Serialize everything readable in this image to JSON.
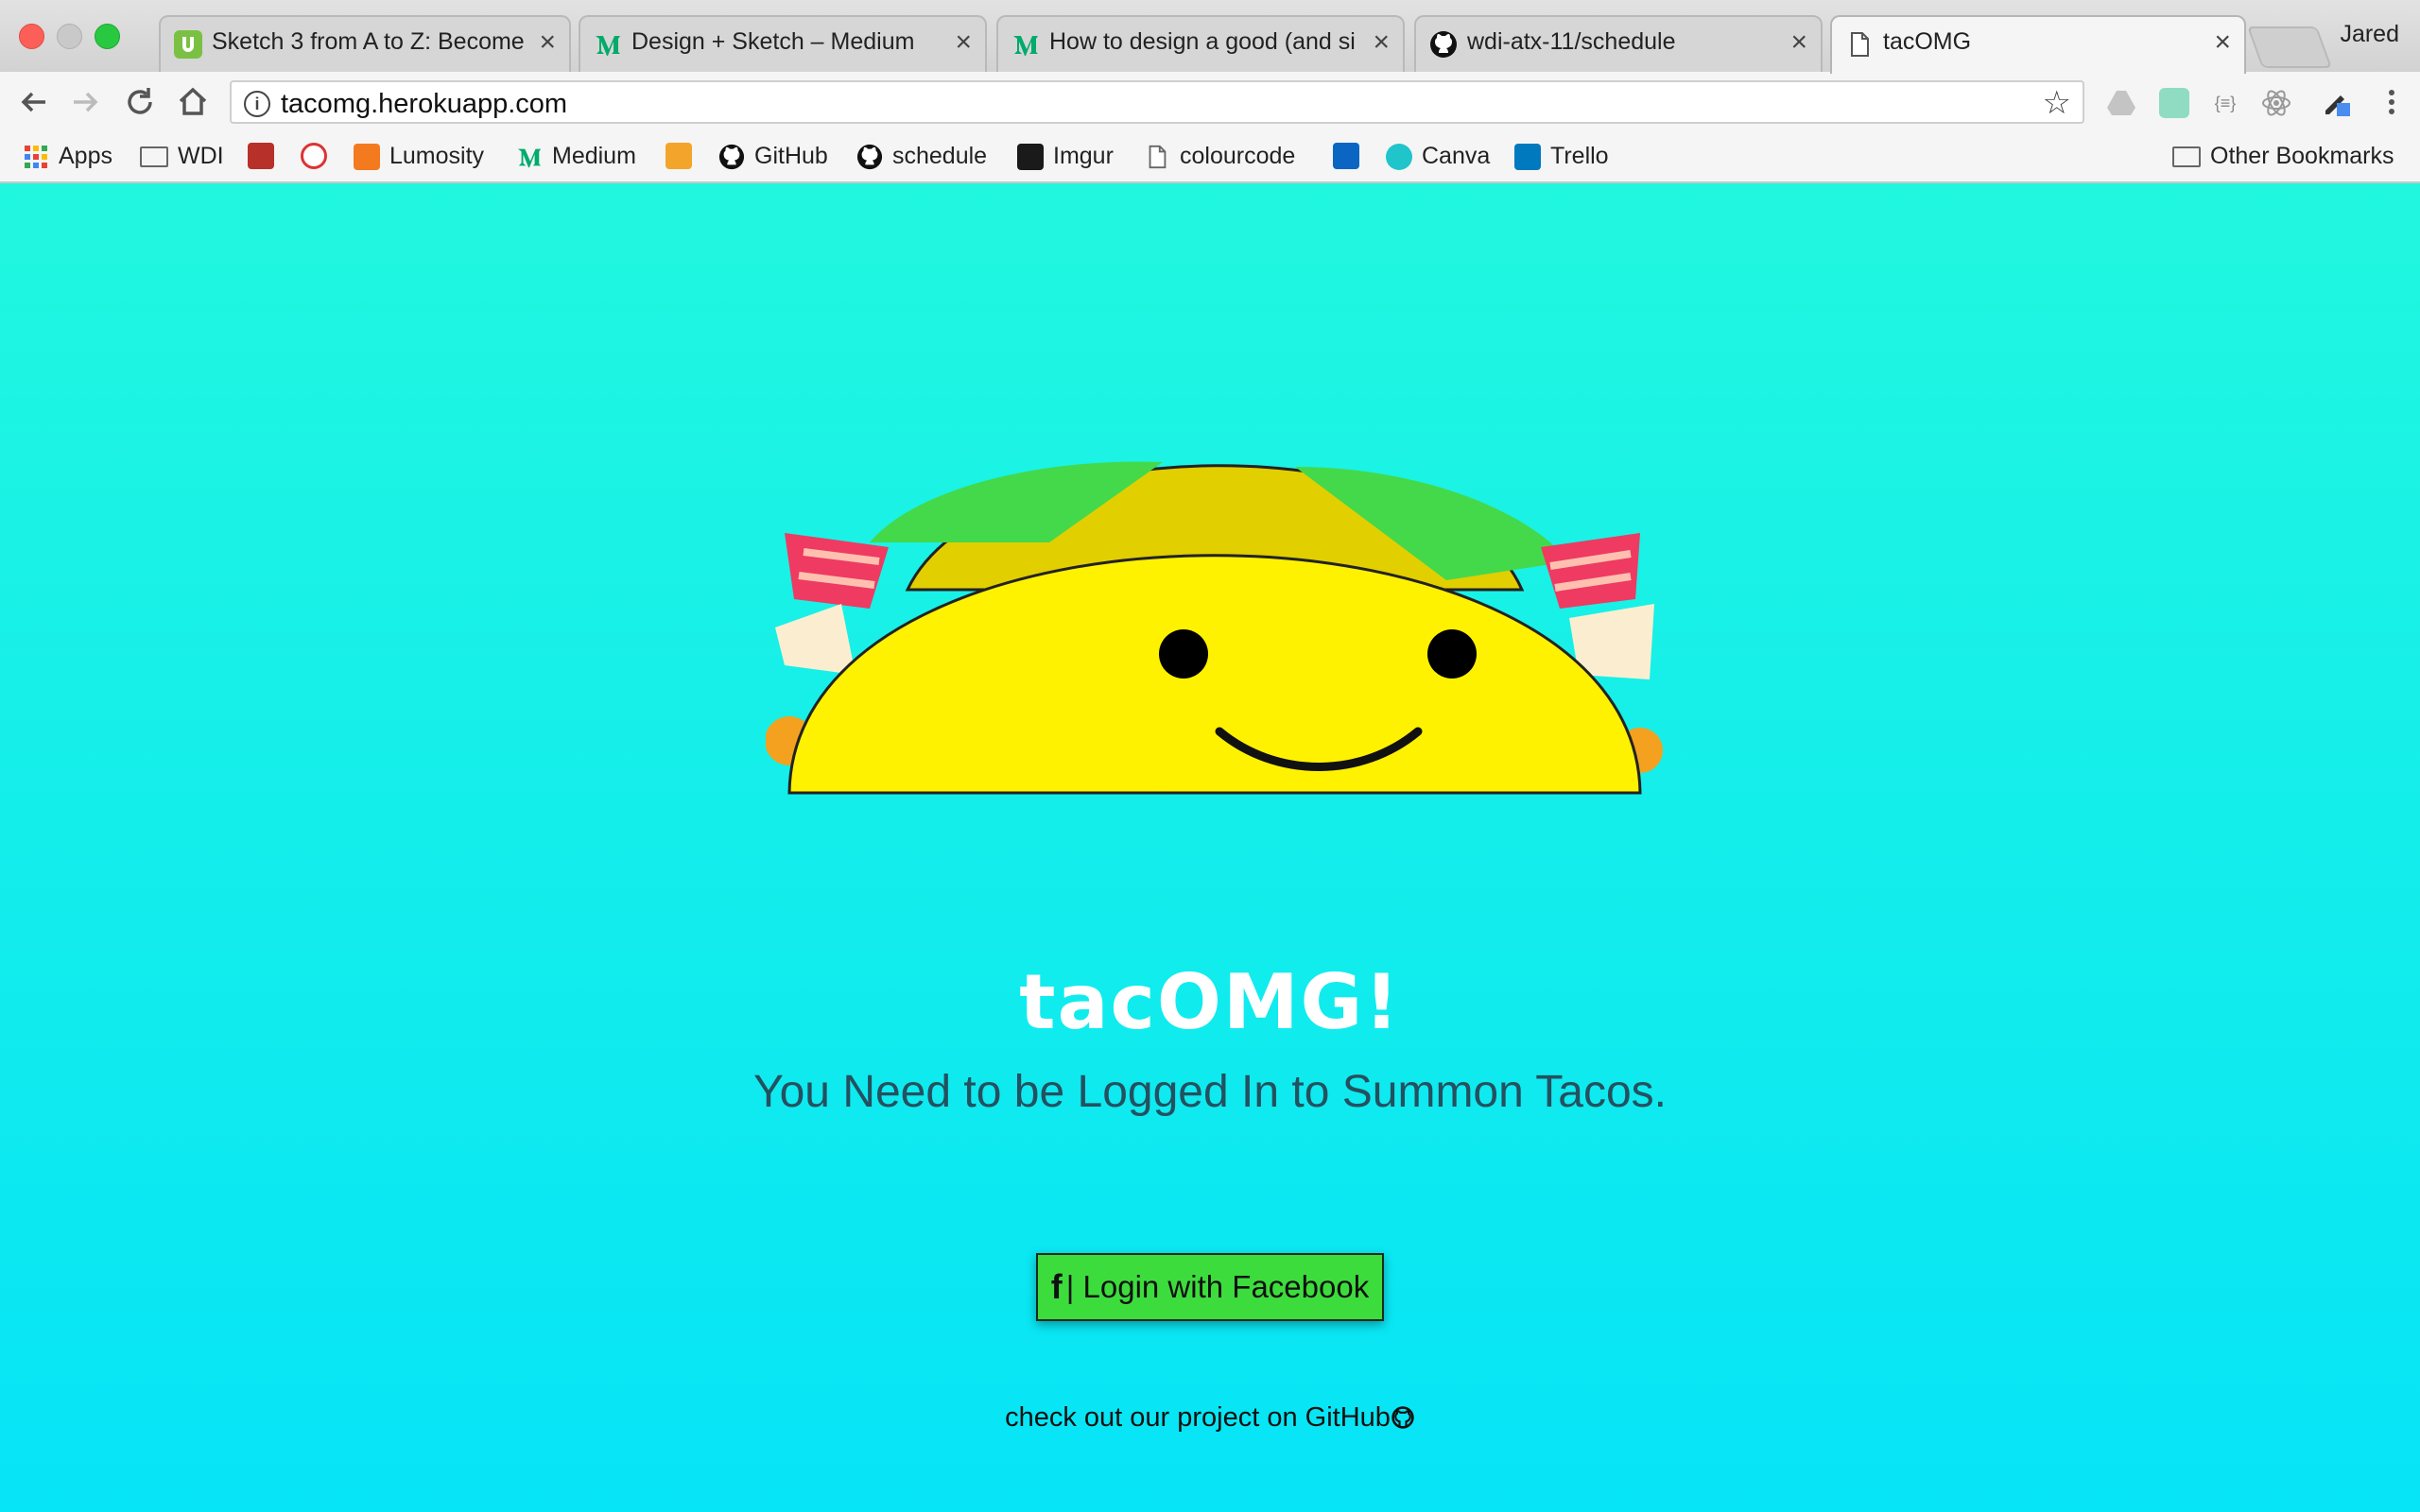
{
  "browser": {
    "tabs": [
      {
        "title": "Sketch 3 from A to Z: Become",
        "favicon": "udemy-icon"
      },
      {
        "title": "Design + Sketch – Medium",
        "favicon": "medium-icon"
      },
      {
        "title": "How to design a good (and si",
        "favicon": "medium-icon"
      },
      {
        "title": "wdi-atx-11/schedule",
        "favicon": "github-icon"
      },
      {
        "title": "tacOMG",
        "favicon": "page-icon"
      }
    ],
    "close_glyph": "×",
    "profile_name": "Jared",
    "url": "tacomg.herokuapp.com",
    "bookmarks": [
      {
        "label": "Apps",
        "icon": "apps-grid-icon"
      },
      {
        "label": "WDI",
        "icon": "folder-icon"
      },
      {
        "label": "Lumosity",
        "icon": "lumosity-icon"
      },
      {
        "label": "Medium",
        "icon": "medium-icon"
      },
      {
        "label": "GitHub",
        "icon": "github-icon"
      },
      {
        "label": "schedule",
        "icon": "github-icon"
      },
      {
        "label": "Imgur",
        "icon": "imgur-icon"
      },
      {
        "label": "colourcode",
        "icon": "page-icon"
      },
      {
        "label": "Canva",
        "icon": "canva-icon"
      },
      {
        "label": "Trello",
        "icon": "trello-icon"
      }
    ],
    "other_bookmarks": "Other Bookmarks"
  },
  "page": {
    "brand": "tacOMG!",
    "tagline": "You Need to be Logged In to Summon Tacos.",
    "login_icon": "f",
    "login_label": "| Login with Facebook",
    "github_text": "check out our project on GitHub"
  },
  "colors": {
    "background_top": "#21f7df",
    "background_bottom": "#06e4f7",
    "taco_shell": "#fff200",
    "button": "#3ddc3d",
    "tagline": "#25505f"
  }
}
